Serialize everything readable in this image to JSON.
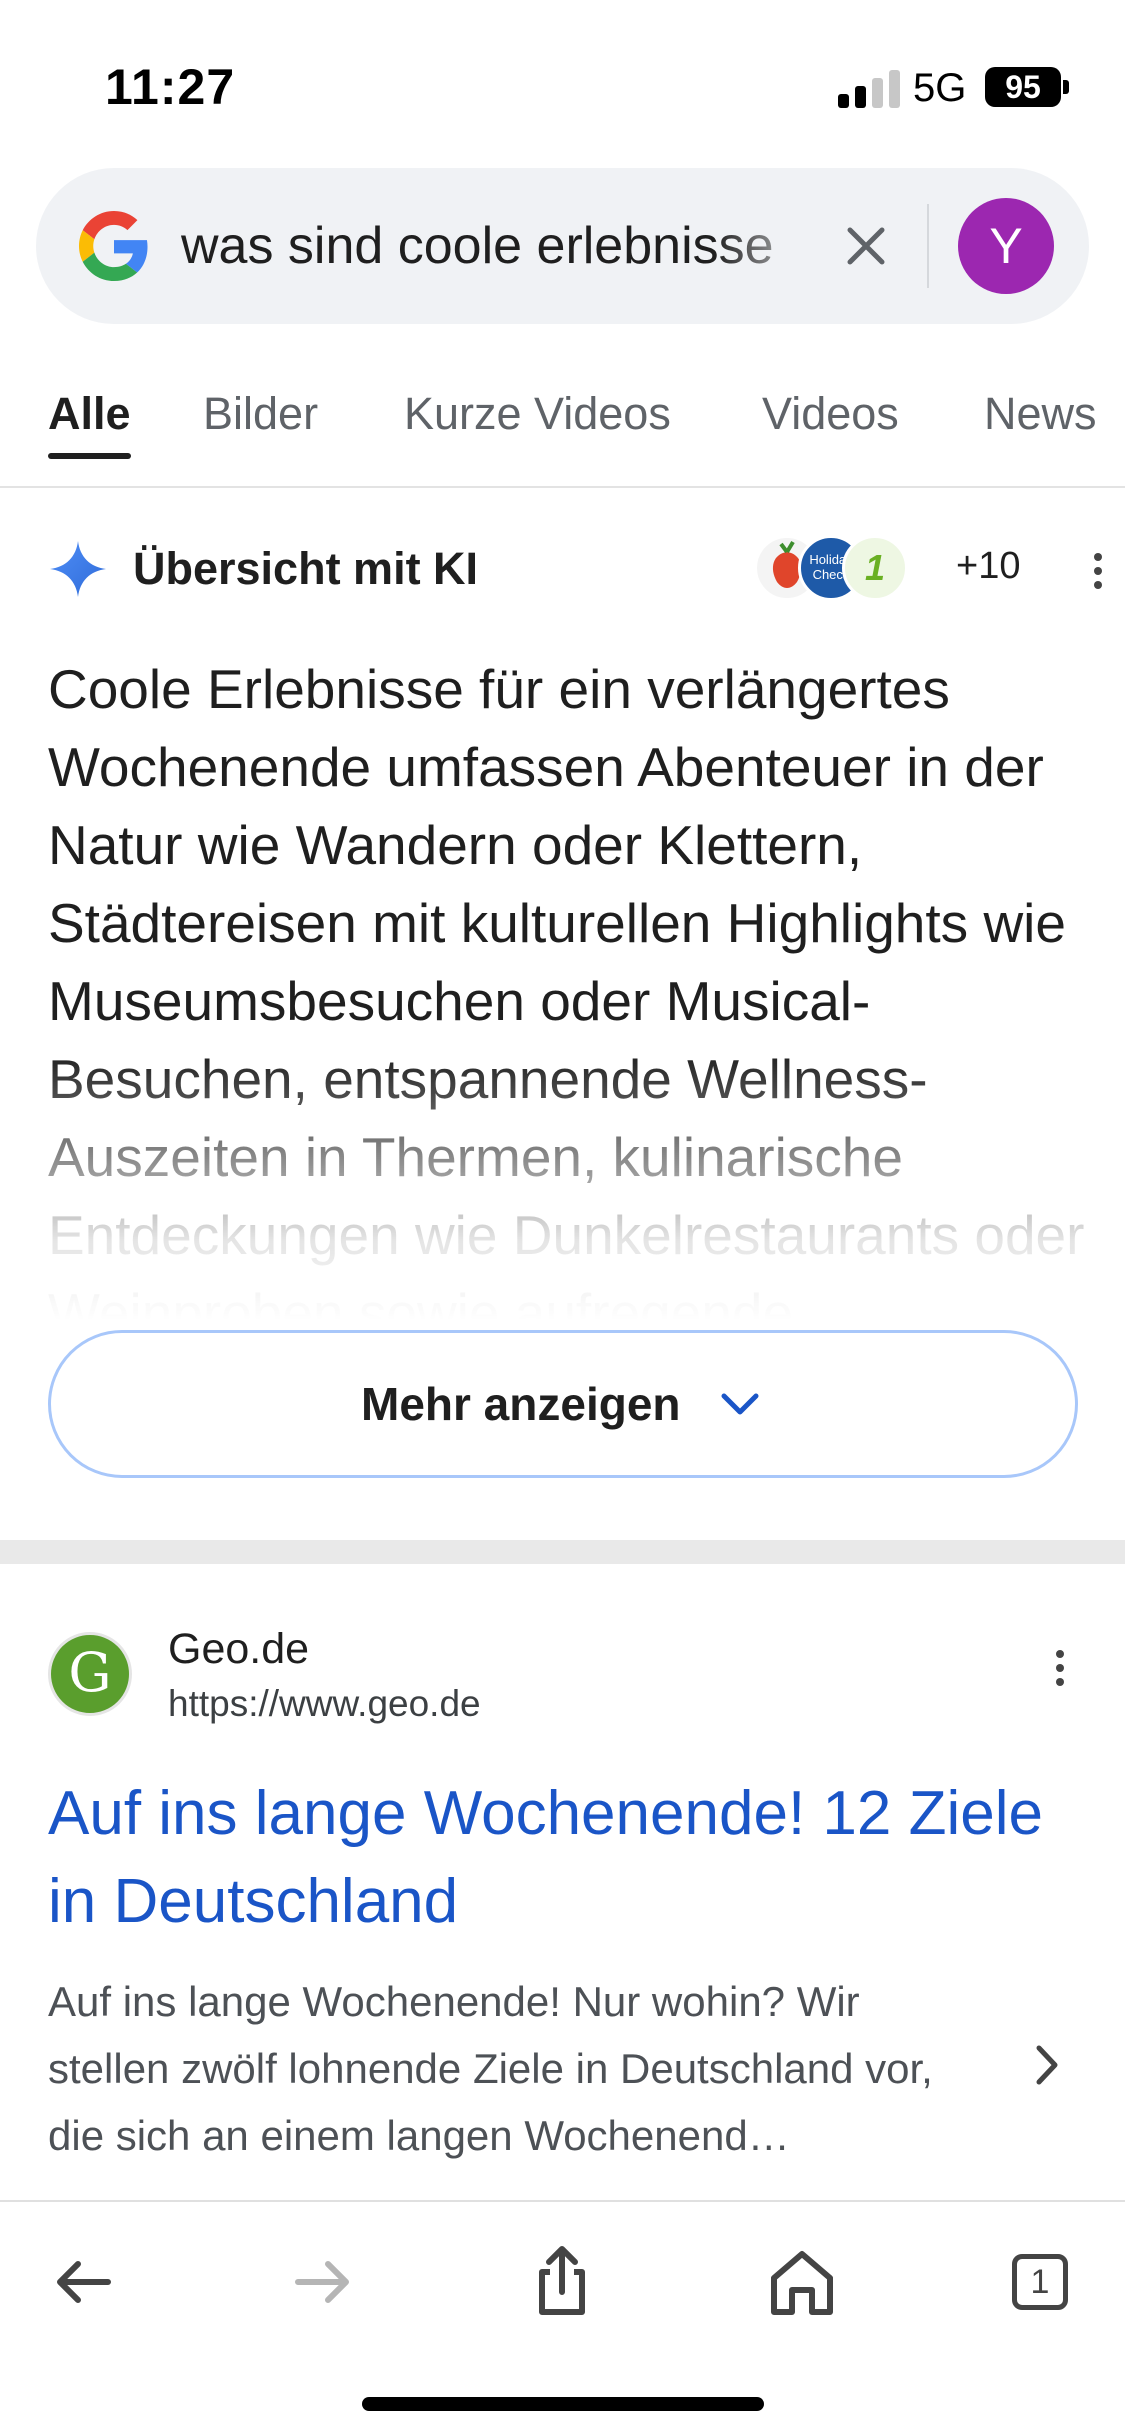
{
  "status_bar": {
    "time": "11:27",
    "network": "5G",
    "battery": "95",
    "icons": [
      "signal-icon",
      "battery-icon"
    ]
  },
  "search": {
    "query": "was sind coole erlebnisse",
    "icons": [
      "google-logo-icon",
      "clear-icon"
    ],
    "avatar_letter": "Y",
    "avatar_color": "#9c27b0"
  },
  "tabs": [
    {
      "label": "Alle",
      "active": true
    },
    {
      "label": "Bilder",
      "active": false
    },
    {
      "label": "Kurze Videos",
      "active": false
    },
    {
      "label": "Videos",
      "active": false
    },
    {
      "label": "News",
      "active": false
    }
  ],
  "ai_overview": {
    "title": "Übersicht mit KI",
    "icon": "sparkle-icon",
    "source_icon_texts": [
      "Holiday Check",
      "1"
    ],
    "sources_more": "+10",
    "text": "Coole Erlebnisse für ein verlängertes Wochenende umfassen Abenteuer in der Natur wie Wandern oder Klettern, Städtereisen mit kulturellen Highlights wie Museumsbesuchen oder Musical-Besuchen, entspannende Wellness-Auszeiten in Thermen, kulinarische Entdeckungen wie Dunkelrestaurants oder Weinproben sowie aufregende",
    "more_label": "Mehr anzeigen"
  },
  "result": {
    "logo_letter": "G",
    "site_name": "Geo.de",
    "url": "https://www.geo.de",
    "title": "Auf ins lange Wochenende! 12 Ziele in Deutschland",
    "snippet": "Auf ins lange Wochenende! Nur wohin? Wir stellen zwölf lohnende Ziele in Deutschland vor, die sich an einem langen Wochenend…",
    "link_color": "#1a55c7"
  },
  "toolbar": {
    "tab_count": "1",
    "icons": [
      "back-arrow-icon",
      "forward-arrow-icon",
      "share-icon",
      "home-icon",
      "tabs-icon"
    ]
  },
  "colors": {
    "accent_blue": "#1a55c7",
    "button_border": "#a8c7fa"
  }
}
